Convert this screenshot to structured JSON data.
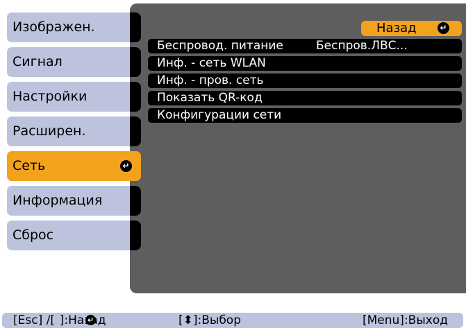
{
  "sidebar": {
    "items": [
      {
        "label": "Изображен."
      },
      {
        "label": "Сигнал"
      },
      {
        "label": "Настройки"
      },
      {
        "label": "Расширен."
      },
      {
        "label": "Сеть"
      },
      {
        "label": "Информация"
      },
      {
        "label": "Сброс"
      }
    ],
    "active_index": 4
  },
  "main": {
    "back_label": "Назад",
    "rows": [
      {
        "label": "Беспровод. питание",
        "value": "Беспров.ЛВС..."
      },
      {
        "label": "Инф. - сеть WLAN"
      },
      {
        "label": "Инф. - пров. сеть"
      },
      {
        "label": "Показать QR-код"
      },
      {
        "label": "Конфигурации сети"
      }
    ]
  },
  "footer": {
    "back_hint": "[Esc] /[  ]:Назад",
    "select_hint": "[⬍]:Выбор",
    "exit_hint": "[Menu]:Выход"
  },
  "colors": {
    "accent": "#f2a21c",
    "sidebar_bg": "#bdc3dd",
    "panel_bg": "#5e5e5e"
  },
  "icons": {
    "enter": "enter-icon"
  }
}
